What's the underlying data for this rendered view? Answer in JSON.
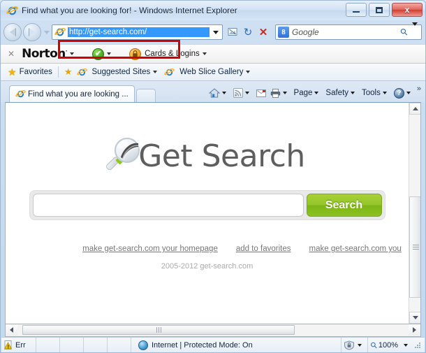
{
  "window": {
    "title": "Find what you are looking for! - Windows Internet Explorer",
    "app_icon": "internet-explorer-icon",
    "minimize_label": "Minimize",
    "maximize_label": "Maximize",
    "close_label": "x"
  },
  "nav": {
    "back_label": "Back",
    "forward_label": "Forward",
    "recent_pages_label": "Recent Pages",
    "address": {
      "icon": "internet-explorer-icon",
      "value": "http://get-search.com/",
      "placeholder": "http://get-search.com/",
      "selected": true,
      "highlight_color": "#3399ff"
    },
    "compatibility_label": "Compatibility View",
    "refresh_glyph": "↻",
    "stop_glyph": "✕",
    "search": {
      "engine_icon": "google-icon",
      "engine_glyph": "8",
      "placeholder": "Google",
      "go_glyph": "⚲"
    },
    "annotation_color": "#d00000"
  },
  "norton_bar": {
    "close_glyph": "✕",
    "brand": "Norton",
    "brand_mark": "·",
    "status_icon": "green-check-icon",
    "status_glyph": "✔",
    "cards_icon": "orange-lock-icon",
    "cards_glyph": "🔒",
    "cards_label": "Cards & Logins"
  },
  "favorites_bar": {
    "favorites_icon": "star-icon",
    "favorites_label": "Favorites",
    "add_icon": "add-to-favorites-icon",
    "items": [
      {
        "label": "Suggested Sites",
        "icon": "internet-explorer-icon"
      },
      {
        "label": "Web Slice Gallery",
        "icon": "internet-explorer-icon"
      }
    ]
  },
  "tabs": {
    "active": "Find what you are looking ...",
    "new_tab_label": "New Tab"
  },
  "command_bar": {
    "home_label": "Home",
    "feeds_label": "Feeds",
    "mail_label": "Read Mail",
    "print_label": "Print",
    "page_label": "Page",
    "safety_label": "Safety",
    "tools_label": "Tools",
    "help_glyph": "?",
    "overflow_glyph": "»"
  },
  "page": {
    "logo_icon": "magnifier-icon",
    "logo_text": "Get Search",
    "logo_color": "#5e5e5e",
    "search_input_value": "",
    "search_input_placeholder": "",
    "search_button_label": "Search",
    "search_button_color": "#8cc221",
    "links": [
      "make get-search.com your homepage",
      "add to favorites",
      "make get-search.com you"
    ],
    "copyright": "2005-2012 get-search.com"
  },
  "scrollbars": {
    "v_up_label": "Scroll up",
    "v_down_label": "Scroll down",
    "h_left_label": "Scroll left",
    "h_right_label": "Scroll right"
  },
  "status_bar": {
    "error_icon": "warning-icon",
    "error_text": "Err",
    "zone_icon": "internet-zone-icon",
    "zone_text": "Internet | Protected Mode: On",
    "privacy_icon": "privacy-report-icon",
    "zoom_icon": "zoom-icon",
    "zoom_level": "100%"
  }
}
